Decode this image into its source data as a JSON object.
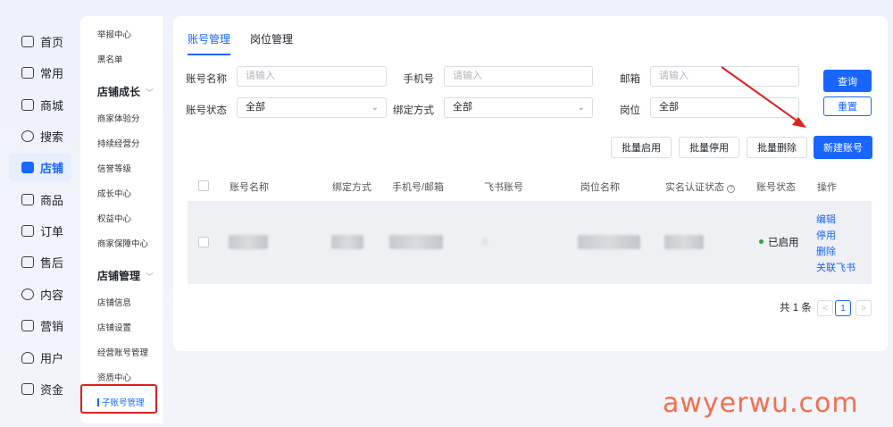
{
  "rail": [
    {
      "label": "首页",
      "icon": "home-icon"
    },
    {
      "label": "常用",
      "icon": "folder-icon"
    },
    {
      "label": "商城",
      "icon": "mall-icon"
    },
    {
      "label": "搜索",
      "icon": "search-icon"
    },
    {
      "label": "店铺",
      "icon": "shop-icon",
      "active": true
    },
    {
      "label": "商品",
      "icon": "goods-icon"
    },
    {
      "label": "订单",
      "icon": "order-icon"
    },
    {
      "label": "售后",
      "icon": "aftersale-icon"
    },
    {
      "label": "内容",
      "icon": "content-icon"
    },
    {
      "label": "营销",
      "icon": "marketing-icon"
    },
    {
      "label": "用户",
      "icon": "user-icon"
    },
    {
      "label": "资金",
      "icon": "wallet-icon"
    }
  ],
  "subnav": {
    "top_items": [
      "举报中心",
      "黑名单"
    ],
    "group1": "店铺成长",
    "group1_items": [
      "商家体验分",
      "持续经营分",
      "信誉等级",
      "成长中心",
      "权益中心",
      "商家保障中心"
    ],
    "group2": "店铺管理",
    "group2_items": [
      "店铺信息",
      "店铺设置",
      "经营账号管理",
      "资质中心",
      "子账号管理"
    ]
  },
  "tabs": [
    "账号管理",
    "岗位管理"
  ],
  "filters": {
    "account_name_label": "账号名称",
    "account_name_placeholder": "请输入",
    "phone_label": "手机号",
    "phone_placeholder": "请输入",
    "email_label": "邮箱",
    "email_placeholder": "请输入",
    "account_status_label": "账号状态",
    "account_status_value": "全部",
    "bind_method_label": "绑定方式",
    "bind_method_value": "全部",
    "position_label": "岗位",
    "position_value": "全部"
  },
  "buttons": {
    "query": "查询",
    "reset": "重置",
    "batch_enable": "批量启用",
    "batch_disable": "批量停用",
    "batch_delete": "批量删除",
    "new_account": "新建账号"
  },
  "table": {
    "columns": [
      "账号名称",
      "绑定方式",
      "手机号/邮箱",
      "飞书账号",
      "岗位名称",
      "实名认证状态",
      "账号状态",
      "操作"
    ],
    "rows": [
      {
        "status": "已启用",
        "actions": [
          "编辑",
          "停用",
          "删除",
          "关联飞书"
        ]
      }
    ]
  },
  "pager": {
    "total": "共 1 条",
    "prev": "<",
    "page": "1",
    "next": ">"
  },
  "watermark": "awyerwu.com",
  "colors": {
    "accent": "#1966ff",
    "annotation_red": "#e02020",
    "status_green": "#2aa34a"
  }
}
